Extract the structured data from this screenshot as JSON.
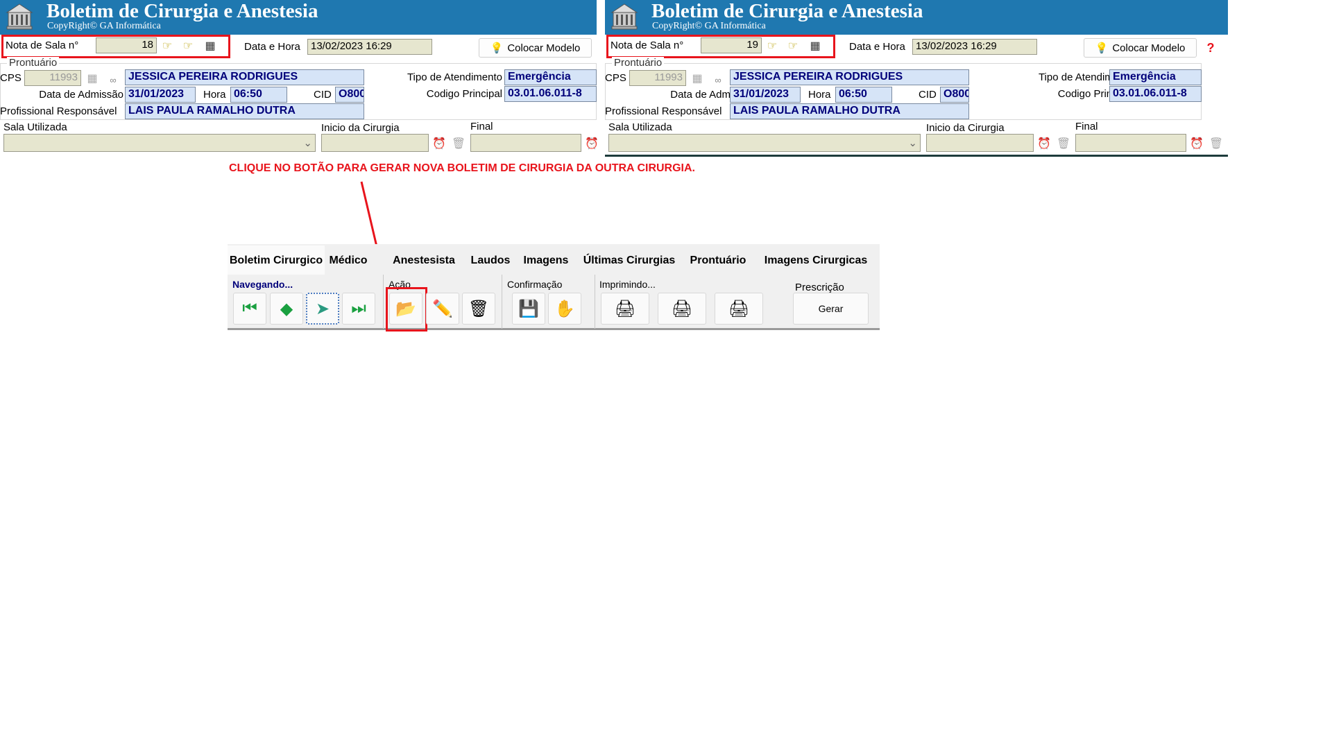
{
  "panels": [
    {
      "title": "Boletim de Cirurgia e Anestesia",
      "copyright": "CopyRight© GA Informática",
      "nota_label": "Nota de Sala n°",
      "nota_value": "18",
      "data_hora_label": "Data e Hora",
      "data_hora_value": "13/02/2023 16:29",
      "colocar_modelo": "Colocar Modelo",
      "prontuario": "Prontuário",
      "cps_label": "CPS",
      "cps_value": "11993",
      "patient": "JESSICA PEREIRA RODRIGUES",
      "tipo_label": "Tipo de Atendimento",
      "tipo_value": "Emergência",
      "admissao_label": "Data de Admissão",
      "admissao_value": "31/01/2023",
      "hora_label": "Hora",
      "hora_value": "06:50",
      "cid_label": "CID",
      "cid_value": "O800",
      "codigo_label": "Codigo Principal",
      "codigo_value": "03.01.06.011-8",
      "prof_label": "Profissional Responsável",
      "prof_value": "LAIS PAULA RAMALHO DUTRA",
      "sala_label": "Sala Utilizada",
      "inicio_label": "Inicio da Cirurgia",
      "final_label": "Final"
    },
    {
      "title": "Boletim de Cirurgia e Anestesia",
      "copyright": "CopyRight© GA Informática",
      "nota_label": "Nota de Sala n°",
      "nota_value": "19",
      "data_hora_label": "Data e Hora",
      "data_hora_value": "13/02/2023 16:29",
      "colocar_modelo": "Colocar Modelo",
      "prontuario": "Prontuário",
      "cps_label": "CPS",
      "cps_value": "11993",
      "patient": "JESSICA PEREIRA RODRIGUES",
      "tipo_label": "Tipo de Atendimento",
      "tipo_value": "Emergência",
      "admissao_label": "Data de Admissão",
      "admissao_value": "31/01/2023",
      "hora_label": "Hora",
      "hora_value": "06:50",
      "cid_label": "CID",
      "cid_value": "O800",
      "codigo_label": "Codigo Principal",
      "codigo_value": "03.01.06.011-8",
      "prof_label": "Profissional Responsável",
      "prof_value": "LAIS PAULA RAMALHO DUTRA",
      "sala_label": "Sala Utilizada",
      "inicio_label": "Inicio da Cirurgia",
      "final_label": "Final",
      "help": "?"
    }
  ],
  "annotation": "CLIQUE NO BOTÃO PARA GERAR NOVA BOLETIM DE CIRURGIA DA OUTRA CIRURGIA.",
  "tabs": [
    "Boletim Cirurgico",
    "Médico",
    "Anestesista",
    "Laudos",
    "Imagens",
    "Últimas Cirurgias",
    "Prontuário",
    "Imagens Cirurgicas"
  ],
  "toolbar": {
    "navegando": "Navegando...",
    "acao": "Ação",
    "confirmacao": "Confirmação",
    "imprimindo": "Imprimindo...",
    "prescricao": "Prescrição",
    "gerar": "Gerar"
  },
  "colors": {
    "header": "#1f78b0",
    "highlight": "#e8141c",
    "field_blue": "#d6e4f7"
  }
}
